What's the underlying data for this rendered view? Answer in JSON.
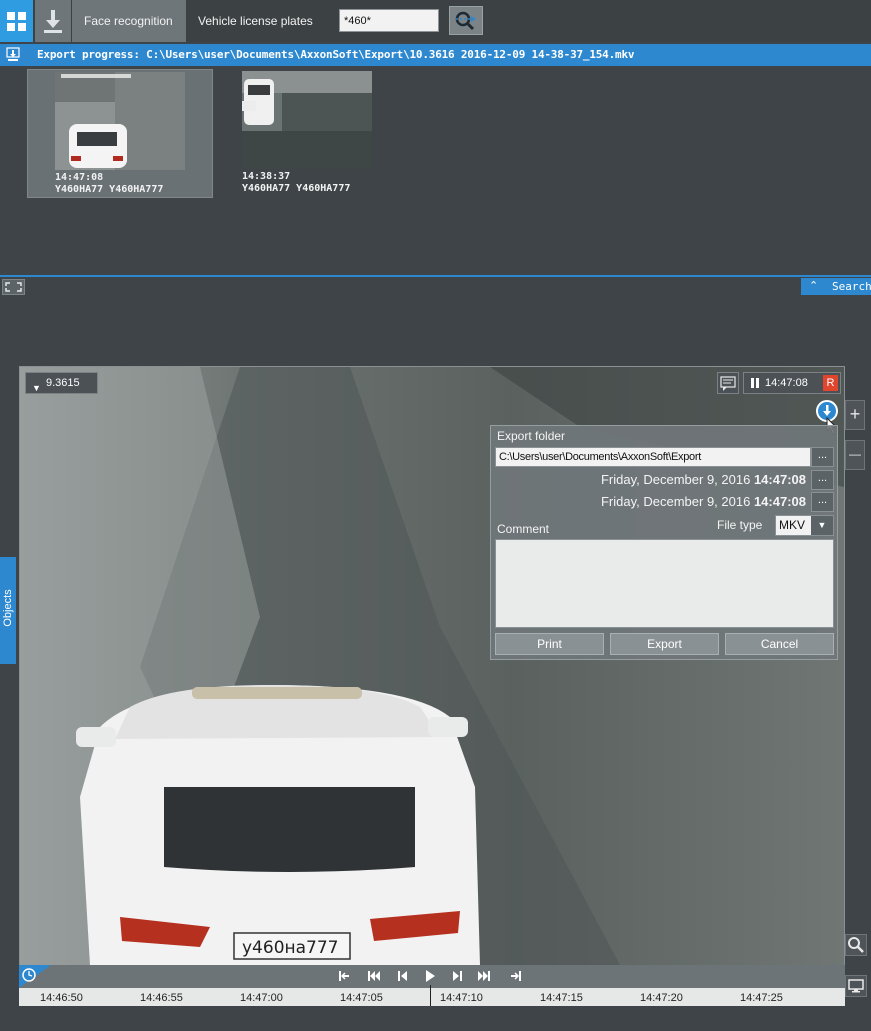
{
  "topbar": {
    "tabs": [
      {
        "label": "Face recognition",
        "active": true
      },
      {
        "label": "Vehicle license plates",
        "active": false
      }
    ],
    "search_value": "*460*",
    "icons": [
      "grid-icon",
      "download-icon",
      "search-go-icon"
    ]
  },
  "progress": {
    "text": "Export progress: C:\\Users\\user\\Documents\\AxxonSoft\\Export\\10.3616 2016-12-09 14-38-37_154.mkv"
  },
  "results": [
    {
      "time": "14:47:08",
      "plates": "Y460HA77 Y460HA777",
      "selected": true
    },
    {
      "time": "14:38:37",
      "plates": "Y460HA77 Y460HA777",
      "selected": false
    }
  ],
  "search_tab": {
    "label": "Search"
  },
  "objects_tab": {
    "label": "Objects"
  },
  "camera": {
    "label": "9.3615",
    "time": "14:47:08",
    "rec": "R"
  },
  "export_dialog": {
    "folder_label": "Export folder",
    "folder_path": "C:\\Users\\user\\Documents\\AxxonSoft\\Export",
    "start_date": "Friday, December 9, 2016",
    "start_time": "14:47:08",
    "end_date": "Friday, December 9, 2016",
    "end_time": "14:47:08",
    "browse": "...",
    "comment_label": "Comment",
    "file_type_label": "File type",
    "file_type": "MKV",
    "buttons": {
      "print": "Print",
      "export": "Export",
      "cancel": "Cancel"
    }
  },
  "side_buttons": {
    "plus": "+",
    "minus": "—"
  },
  "timeline": {
    "ticks": [
      "14:46:50",
      "14:46:55",
      "14:47:00",
      "14:47:05",
      "14:47:10",
      "14:47:15",
      "14:47:20",
      "14:47:25"
    ]
  },
  "colors": {
    "accent": "#2d88cf",
    "rec": "#e0452d",
    "panel": "#3e4447"
  }
}
